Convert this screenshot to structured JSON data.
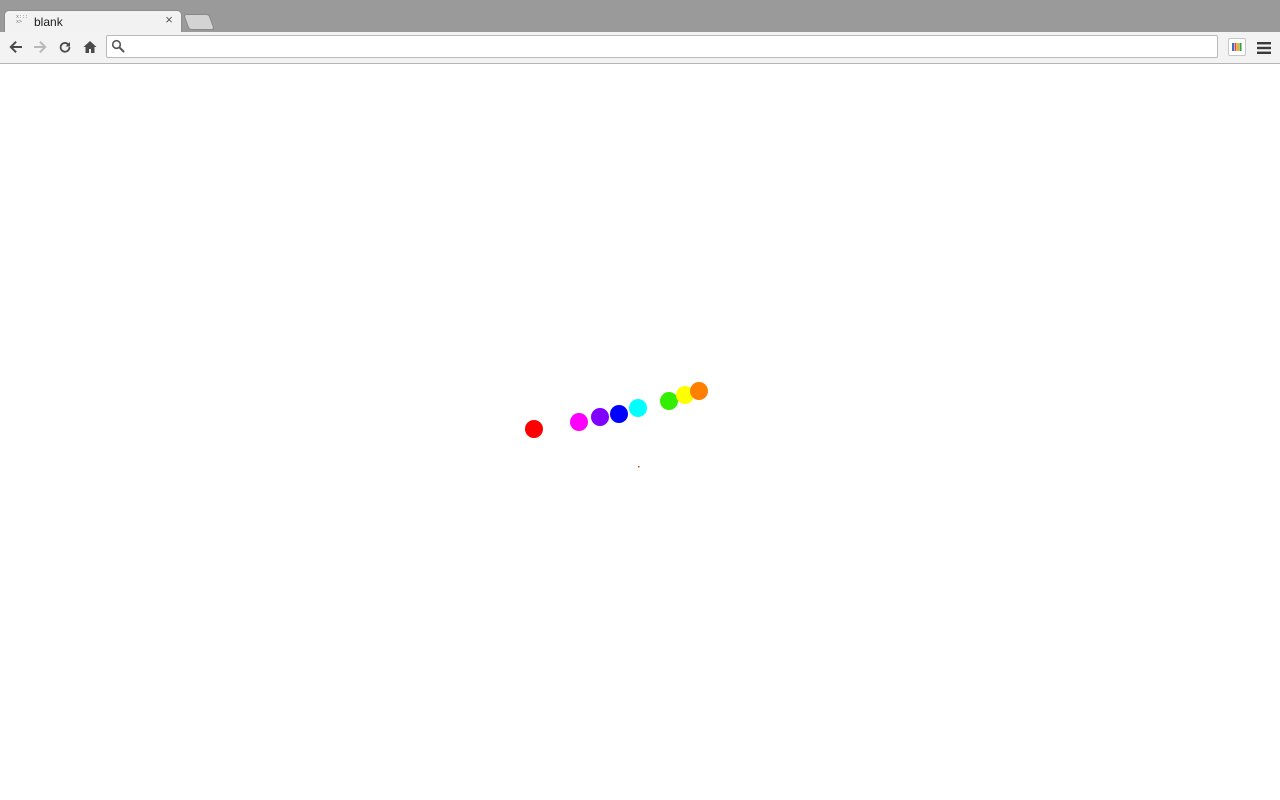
{
  "browser": {
    "tab": {
      "title": "blank",
      "favicon_icon": "document-icon",
      "close_label": "×"
    },
    "new_tab_icon": "new-tab-icon",
    "toolbar": {
      "back_icon": "back-arrow-icon",
      "forward_icon": "forward-arrow-icon",
      "reload_icon": "reload-icon",
      "home_icon": "home-icon",
      "search_icon": "search-icon",
      "address_value": "",
      "extension_icon": "color-bars-icon",
      "menu_icon": "hamburger-menu-icon"
    }
  },
  "page": {
    "colors": [
      "#ff0000",
      "#ff00ff",
      "#7f00ff",
      "#0000ff",
      "#00ffff",
      "#33ee00",
      "#ffff00",
      "#ff7f00"
    ],
    "background": "#ffffff"
  }
}
